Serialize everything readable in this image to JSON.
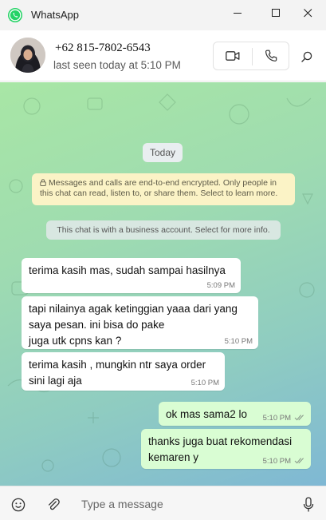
{
  "window": {
    "app_name": "WhatsApp",
    "logo_icon": "whatsapp-logo-icon",
    "controls": [
      "minimize-icon",
      "maximize-icon",
      "close-icon"
    ]
  },
  "header": {
    "contact_name": "+62 815-7802-6543",
    "status": "last seen today at 5:10 PM",
    "actions": [
      "video-call-icon",
      "voice-call-icon",
      "search-icon"
    ]
  },
  "chat": {
    "date_chip": "Today",
    "encryption_notice": "Messages and calls are end-to-end encrypted. Only people in this chat can read, listen to, or share them. Select to learn more.",
    "business_notice": "This chat is with a business account. Select for more info.",
    "messages": [
      {
        "direction": "incoming",
        "text": "terima kasih mas, sudah sampai hasilnya",
        "time": "5:09 PM"
      },
      {
        "direction": "incoming",
        "text": "tapi nilainya agak ketinggian yaaa dari yang saya pesan. ini bisa do pake\njuga utk cpns kan ?",
        "time": "5:10 PM"
      },
      {
        "direction": "incoming",
        "text": "terima kasih , mungkin ntr saya order sini lagi aja",
        "time": "5:10 PM"
      },
      {
        "direction": "outgoing",
        "text": "ok mas sama2 lo",
        "time": "5:10 PM"
      },
      {
        "direction": "outgoing",
        "text": "thanks juga buat rekomendasi kemaren y",
        "time": "5:10 PM"
      }
    ]
  },
  "composer": {
    "placeholder": "Type a message",
    "icons": [
      "emoji-icon",
      "attach-icon",
      "microphone-icon"
    ]
  },
  "colors": {
    "brand": "#25d366",
    "outgoing_bubble": "#d9fdd3",
    "incoming_bubble": "#ffffff",
    "read_ticks": "#8a9a8a"
  }
}
